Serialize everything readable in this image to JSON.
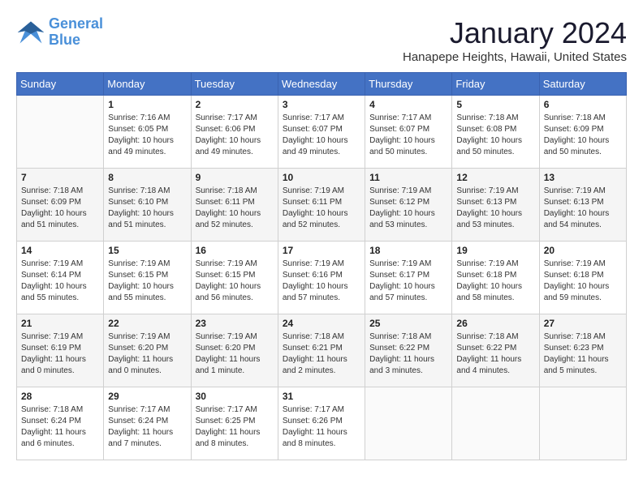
{
  "header": {
    "logo_line1": "General",
    "logo_line2": "Blue",
    "month": "January 2024",
    "location": "Hanapepe Heights, Hawaii, United States"
  },
  "weekdays": [
    "Sunday",
    "Monday",
    "Tuesday",
    "Wednesday",
    "Thursday",
    "Friday",
    "Saturday"
  ],
  "weeks": [
    [
      {
        "day": "",
        "info": ""
      },
      {
        "day": "1",
        "info": "Sunrise: 7:16 AM\nSunset: 6:05 PM\nDaylight: 10 hours\nand 49 minutes."
      },
      {
        "day": "2",
        "info": "Sunrise: 7:17 AM\nSunset: 6:06 PM\nDaylight: 10 hours\nand 49 minutes."
      },
      {
        "day": "3",
        "info": "Sunrise: 7:17 AM\nSunset: 6:07 PM\nDaylight: 10 hours\nand 49 minutes."
      },
      {
        "day": "4",
        "info": "Sunrise: 7:17 AM\nSunset: 6:07 PM\nDaylight: 10 hours\nand 50 minutes."
      },
      {
        "day": "5",
        "info": "Sunrise: 7:18 AM\nSunset: 6:08 PM\nDaylight: 10 hours\nand 50 minutes."
      },
      {
        "day": "6",
        "info": "Sunrise: 7:18 AM\nSunset: 6:09 PM\nDaylight: 10 hours\nand 50 minutes."
      }
    ],
    [
      {
        "day": "7",
        "info": "Sunrise: 7:18 AM\nSunset: 6:09 PM\nDaylight: 10 hours\nand 51 minutes."
      },
      {
        "day": "8",
        "info": "Sunrise: 7:18 AM\nSunset: 6:10 PM\nDaylight: 10 hours\nand 51 minutes."
      },
      {
        "day": "9",
        "info": "Sunrise: 7:18 AM\nSunset: 6:11 PM\nDaylight: 10 hours\nand 52 minutes."
      },
      {
        "day": "10",
        "info": "Sunrise: 7:19 AM\nSunset: 6:11 PM\nDaylight: 10 hours\nand 52 minutes."
      },
      {
        "day": "11",
        "info": "Sunrise: 7:19 AM\nSunset: 6:12 PM\nDaylight: 10 hours\nand 53 minutes."
      },
      {
        "day": "12",
        "info": "Sunrise: 7:19 AM\nSunset: 6:13 PM\nDaylight: 10 hours\nand 53 minutes."
      },
      {
        "day": "13",
        "info": "Sunrise: 7:19 AM\nSunset: 6:13 PM\nDaylight: 10 hours\nand 54 minutes."
      }
    ],
    [
      {
        "day": "14",
        "info": "Sunrise: 7:19 AM\nSunset: 6:14 PM\nDaylight: 10 hours\nand 55 minutes."
      },
      {
        "day": "15",
        "info": "Sunrise: 7:19 AM\nSunset: 6:15 PM\nDaylight: 10 hours\nand 55 minutes."
      },
      {
        "day": "16",
        "info": "Sunrise: 7:19 AM\nSunset: 6:15 PM\nDaylight: 10 hours\nand 56 minutes."
      },
      {
        "day": "17",
        "info": "Sunrise: 7:19 AM\nSunset: 6:16 PM\nDaylight: 10 hours\nand 57 minutes."
      },
      {
        "day": "18",
        "info": "Sunrise: 7:19 AM\nSunset: 6:17 PM\nDaylight: 10 hours\nand 57 minutes."
      },
      {
        "day": "19",
        "info": "Sunrise: 7:19 AM\nSunset: 6:18 PM\nDaylight: 10 hours\nand 58 minutes."
      },
      {
        "day": "20",
        "info": "Sunrise: 7:19 AM\nSunset: 6:18 PM\nDaylight: 10 hours\nand 59 minutes."
      }
    ],
    [
      {
        "day": "21",
        "info": "Sunrise: 7:19 AM\nSunset: 6:19 PM\nDaylight: 11 hours\nand 0 minutes."
      },
      {
        "day": "22",
        "info": "Sunrise: 7:19 AM\nSunset: 6:20 PM\nDaylight: 11 hours\nand 0 minutes."
      },
      {
        "day": "23",
        "info": "Sunrise: 7:19 AM\nSunset: 6:20 PM\nDaylight: 11 hours\nand 1 minute."
      },
      {
        "day": "24",
        "info": "Sunrise: 7:18 AM\nSunset: 6:21 PM\nDaylight: 11 hours\nand 2 minutes."
      },
      {
        "day": "25",
        "info": "Sunrise: 7:18 AM\nSunset: 6:22 PM\nDaylight: 11 hours\nand 3 minutes."
      },
      {
        "day": "26",
        "info": "Sunrise: 7:18 AM\nSunset: 6:22 PM\nDaylight: 11 hours\nand 4 minutes."
      },
      {
        "day": "27",
        "info": "Sunrise: 7:18 AM\nSunset: 6:23 PM\nDaylight: 11 hours\nand 5 minutes."
      }
    ],
    [
      {
        "day": "28",
        "info": "Sunrise: 7:18 AM\nSunset: 6:24 PM\nDaylight: 11 hours\nand 6 minutes."
      },
      {
        "day": "29",
        "info": "Sunrise: 7:17 AM\nSunset: 6:24 PM\nDaylight: 11 hours\nand 7 minutes."
      },
      {
        "day": "30",
        "info": "Sunrise: 7:17 AM\nSunset: 6:25 PM\nDaylight: 11 hours\nand 8 minutes."
      },
      {
        "day": "31",
        "info": "Sunrise: 7:17 AM\nSunset: 6:26 PM\nDaylight: 11 hours\nand 8 minutes."
      },
      {
        "day": "",
        "info": ""
      },
      {
        "day": "",
        "info": ""
      },
      {
        "day": "",
        "info": ""
      }
    ]
  ]
}
